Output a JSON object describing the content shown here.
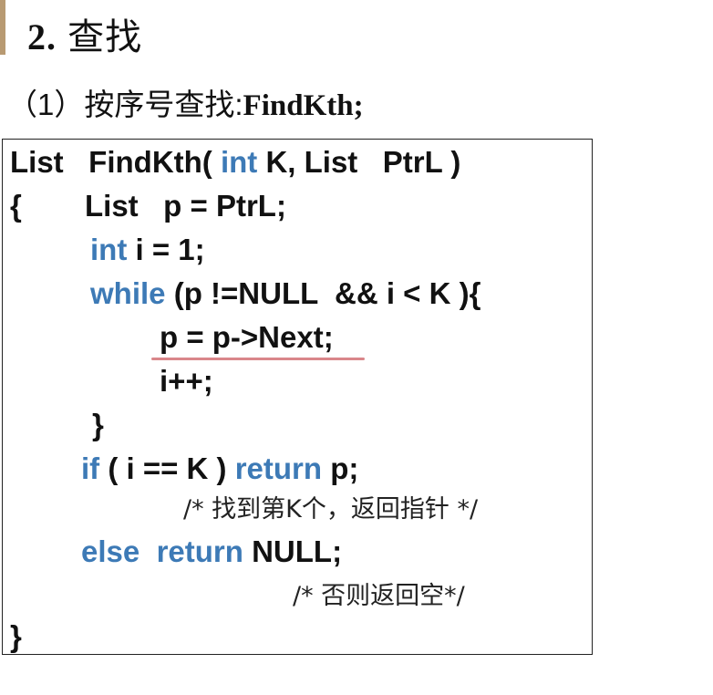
{
  "heading": {
    "number": "2.",
    "title": "查找"
  },
  "subheading": {
    "label": "（1）按序号查找:",
    "function": "FindKth;"
  },
  "code": {
    "line1": {
      "p1": "List   FindKth( ",
      "kw": "int",
      "p2": " K, List   PtrL )"
    },
    "line2": {
      "brace": "{",
      "text": "List   p = PtrL;"
    },
    "line3": {
      "kw": "int",
      "text": " i = 1;"
    },
    "line4": {
      "kw": "while",
      "text": " (p !=NULL  && i < K ){"
    },
    "line5": {
      "text": "p = p->Next;"
    },
    "line6": {
      "text": "i++;"
    },
    "line7": {
      "text": "}"
    },
    "line8": {
      "kw1": "if",
      "p1": " ( i == K ) ",
      "kw2": "return",
      "p2": " p;"
    },
    "comment1": "/* 找到第K个，返回指针 */",
    "line9": {
      "kw1": "else",
      "sep": "  ",
      "kw2": "return",
      "p2": " NULL;"
    },
    "comment2": "/* 否则返回空*/",
    "line10": {
      "text": "}"
    }
  },
  "colors": {
    "keyword": "#3d7ab6",
    "underline": "#d9868a",
    "accent": "#b89a72"
  }
}
